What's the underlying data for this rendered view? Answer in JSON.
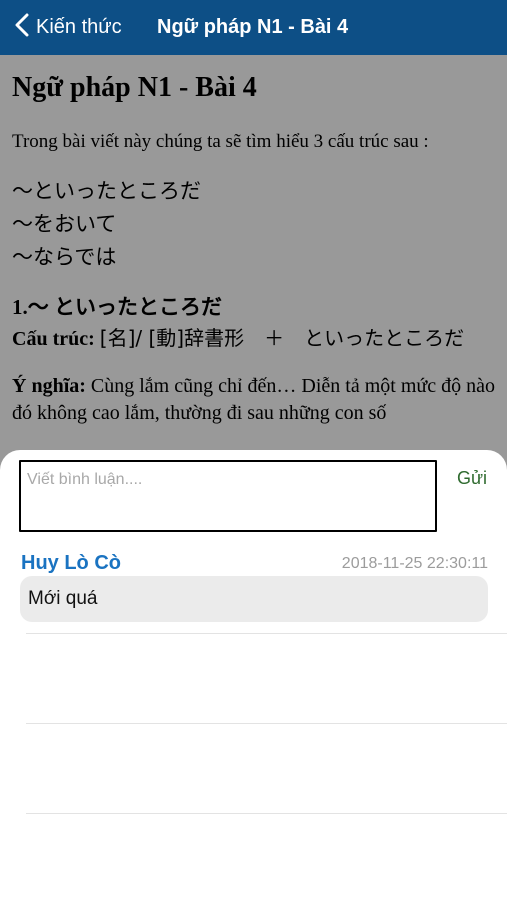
{
  "navbar": {
    "back_label": "Kiến thức",
    "title": "Ngữ pháp N1 - Bài 4",
    "background_color": "#0d4f86"
  },
  "article": {
    "title": "Ngữ pháp N1 - Bài 4",
    "intro": "Trong bài viết này chúng ta sẽ tìm hiểu 3 cấu trúc sau :",
    "patterns": [
      "～といったところだ",
      "～をおいて",
      "～ならでは"
    ],
    "section1": {
      "heading_number": "1.～",
      "heading_pattern": "といったところだ",
      "structure_label": "Cấu trúc:",
      "structure_value": "[名]/ [動]辞書形　＋　といったところだ",
      "meaning_label": "Ý nghĩa:",
      "meaning_text": "Cùng lắm cũng chỉ đến… Diễn tả một mức độ nào đó không cao lắm, thường đi sau những con số"
    }
  },
  "comments_panel": {
    "input_placeholder": "Viết bình luận....",
    "input_value": "",
    "send_label": "Gửi",
    "comments": [
      {
        "author": "Huy Lò Cò",
        "timestamp": "2018-11-25 22:30:11",
        "text": "Mới quá"
      }
    ]
  },
  "colors": {
    "author": "#1a73c1",
    "send": "#2f6b2f",
    "bubble": "#ebebeb"
  }
}
